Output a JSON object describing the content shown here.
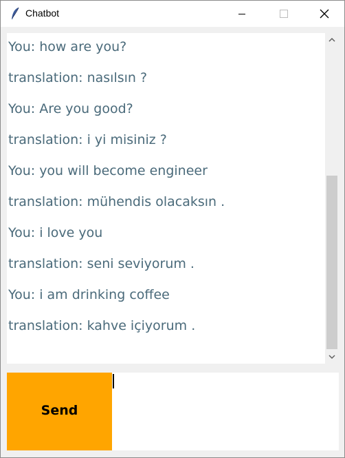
{
  "window": {
    "title": "Chatbot",
    "controls": [
      "minimize-icon",
      "maximize-icon",
      "close-icon"
    ],
    "app_icon": "feather-icon"
  },
  "chat": {
    "messages": [
      "You: how are you?",
      "translation: nasılsın ?",
      "You: Are you good?",
      "translation: i yi misiniz ?",
      "You: you will become engineer",
      "translation: mühendis olacaksın .",
      "You: i love you",
      "translation: seni seviyorum .",
      "You: i am drinking coffee",
      "translation: kahve içiyorum ."
    ],
    "text_color": "#4a6a7a"
  },
  "input": {
    "value": ""
  },
  "send": {
    "label": "Send",
    "color": "#ffa500"
  }
}
